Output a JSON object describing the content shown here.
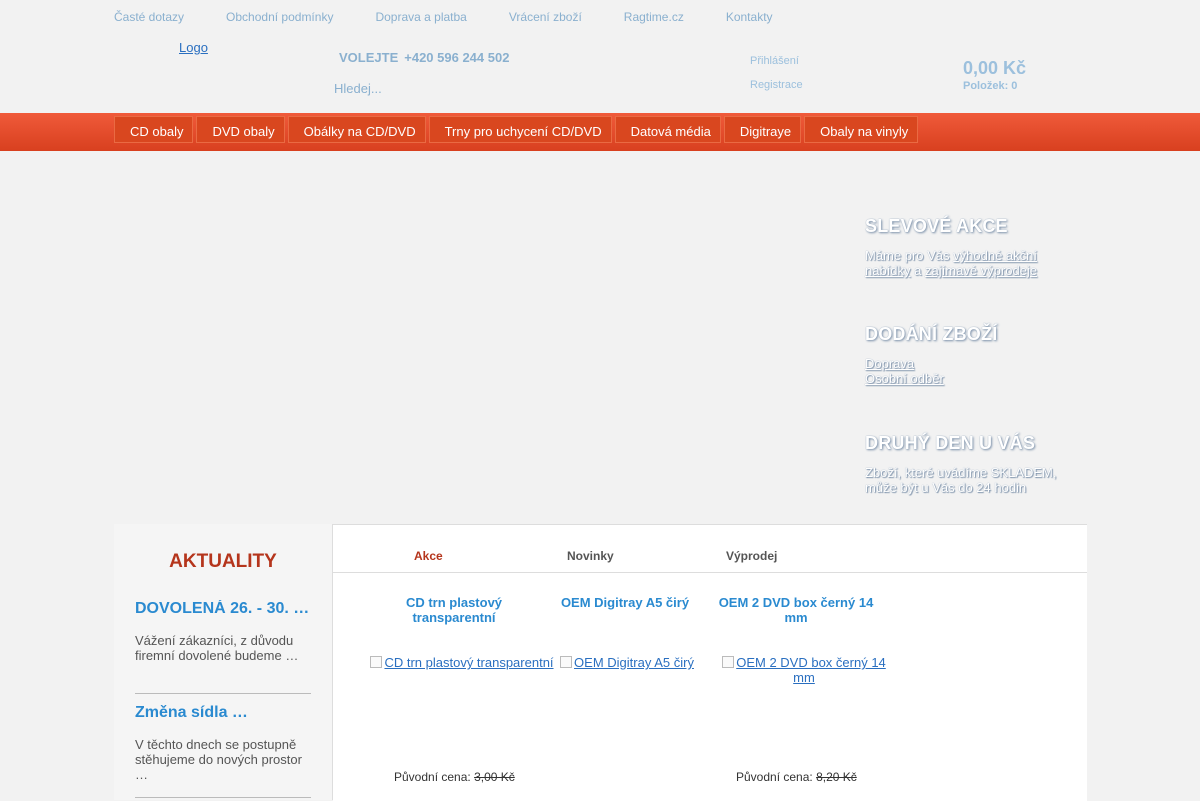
{
  "top_links": [
    "Časté dotazy",
    "Obchodní podmínky",
    "Doprava a platba",
    "Vrácení zboží",
    "Ragtime.cz",
    "Kontakty"
  ],
  "header": {
    "logo_alt": "Logo",
    "call_label": "VOLEJTE",
    "phone": "+420 596 244 502",
    "search_placeholder": "Hledej...",
    "login": "Přihlášení",
    "register": "Registrace",
    "cart_price": "0,00 Kč",
    "cart_count": "Položek: 0"
  },
  "nav": [
    "CD obaly",
    "DVD obaly",
    "Obálky na CD/DVD",
    "Trny pro uchycení CD/DVD",
    "Datová média",
    "Digitraye",
    "Obaly na vinyly"
  ],
  "side": {
    "slevove": {
      "title": "SLEVOVÉ AKCE",
      "pre": "Máme pro Vás",
      "link1": "výhodné akční nabídky",
      "mid": "a",
      "link2": "zajímavé výprodeje"
    },
    "dodani": {
      "title": "DODÁNÍ ZBOŽÍ",
      "link1": "Doprava",
      "link2": "Osobní odběr"
    },
    "druhy": {
      "title": "DRUHÝ DEN U VÁS",
      "text": "Zboží, které uvádíme SKLADEM, může být u Vás do 24 hodin"
    }
  },
  "aktuality": {
    "title": "AKTUALITY",
    "items": [
      {
        "title": "DOVOLENÁ 26. - 30. …",
        "text": "Vážení zákazníci, z důvodu firemní dovolené budeme …"
      },
      {
        "title": "Změna sídla …",
        "text": "V těchto dnech se postupně stěhujeme do nových prostor …"
      }
    ]
  },
  "tabs": [
    "Akce",
    "Novinky",
    "Výprodej"
  ],
  "products": [
    {
      "name": "CD trn plastový transparentní",
      "img_alt": "CD trn plastový transparentní",
      "price_label": "Původní cena:",
      "price_old": "3,00 Kč"
    },
    {
      "name": "OEM Digitray A5 čirý",
      "img_alt": "OEM Digitray A5 čirý",
      "price_label": "",
      "price_old": ""
    },
    {
      "name": "OEM 2 DVD box černý 14 mm",
      "img_alt": "OEM 2 DVD box černý 14 mm",
      "price_label": "Původní cena:",
      "price_old": "8,20 Kč"
    }
  ]
}
